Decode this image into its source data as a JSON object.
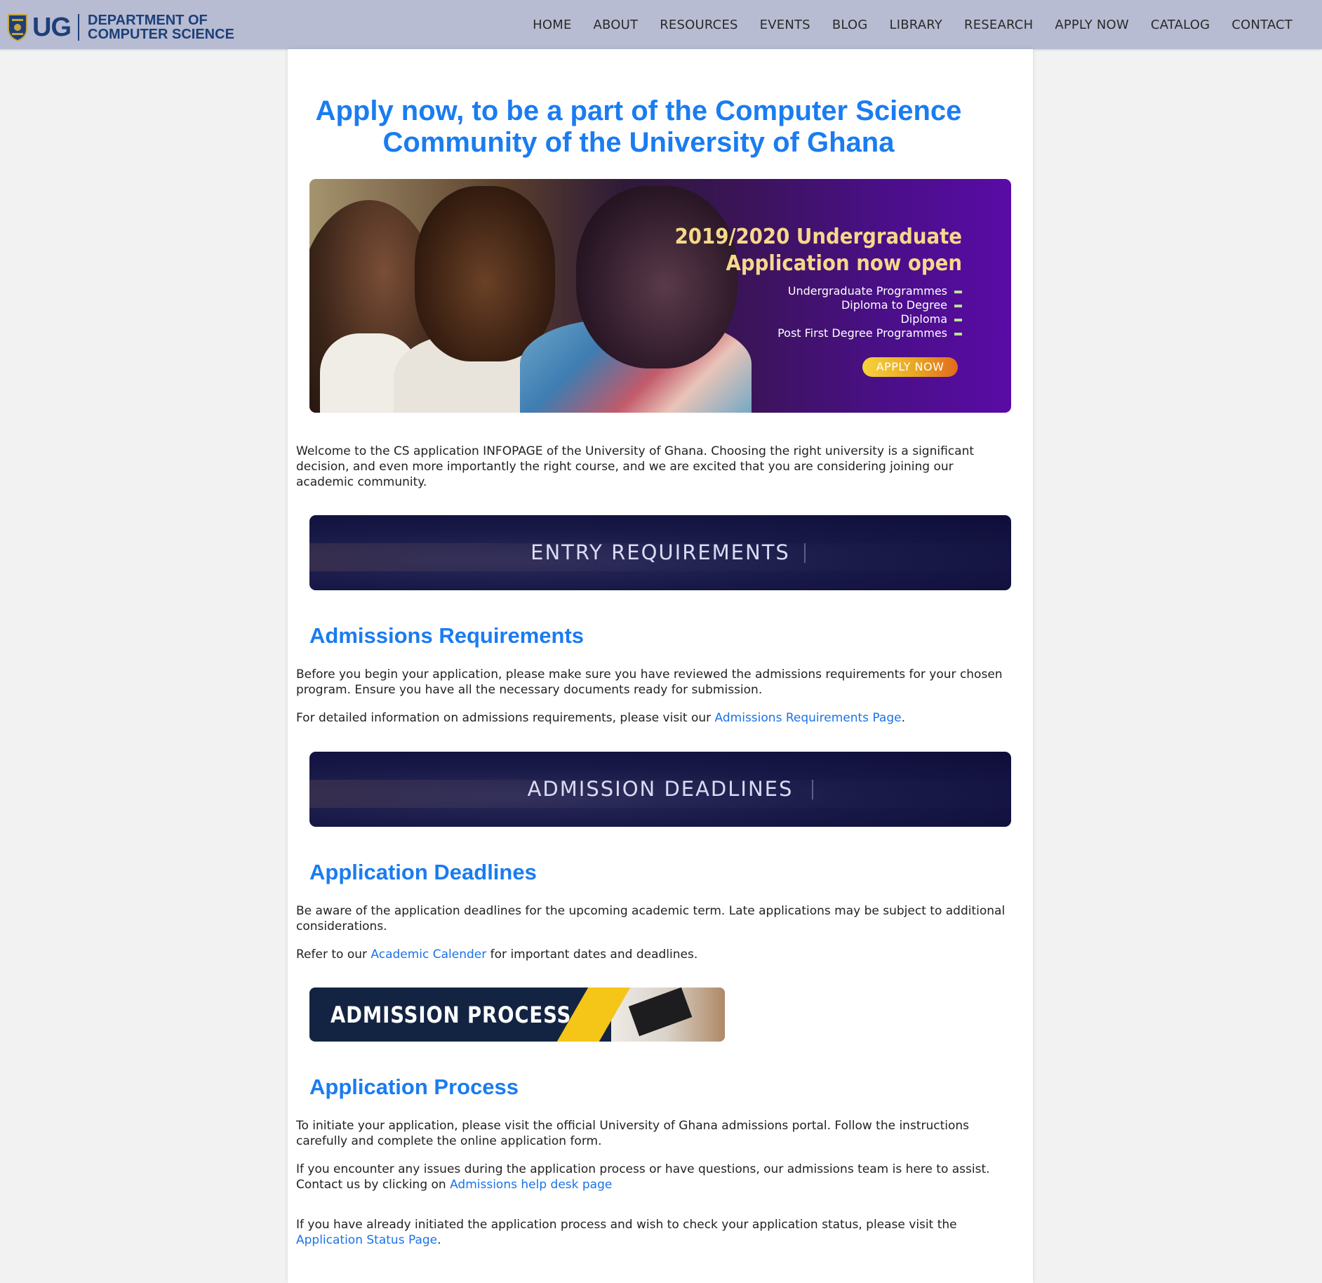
{
  "header": {
    "logo_mark": "UG",
    "dept_line1": "DEPARTMENT OF",
    "dept_line2": "COMPUTER SCIENCE",
    "nav": [
      "HOME",
      "ABOUT",
      "RESOURCES",
      "EVENTS",
      "BLOG",
      "LIBRARY",
      "RESEARCH",
      "APPLY NOW",
      "CATALOG",
      "CONTACT"
    ]
  },
  "main": {
    "headline": "Apply now, to be a part of the Computer Science Community of the University of Ghana",
    "hero": {
      "title_line1": "2019/2020 Undergraduate",
      "title_line2": "Application now open",
      "items": [
        "Undergraduate Programmes",
        "Diploma to Degree",
        "Diploma",
        "Post First Degree Programmes"
      ],
      "button": "APPLY NOW"
    },
    "welcome": "Welcome to the CS application INFOPAGE of the University of Ghana. Choosing the right university is a significant decision, and even more importantly the right course, and we are excited that you are considering joining our academic community.",
    "banner_entry": "ENTRY REQUIREMENTS",
    "admissions": {
      "heading": "Admissions Requirements",
      "p1": "Before you begin your application, please make sure you have reviewed the admissions requirements for your chosen program. Ensure you have all the necessary documents ready for submission.",
      "p2_prefix": "For detailed information on admissions requirements, please visit our ",
      "p2_link": "Admissions Requirements Page",
      "p2_suffix": "."
    },
    "banner_deadlines": "ADMISSION DEADLINES",
    "deadlines": {
      "heading": "Application Deadlines",
      "p1": "Be aware of the application deadlines for the upcoming academic term. Late applications may be subject to additional considerations.",
      "p2_prefix": "Refer to our ",
      "p2_link": "Academic Calender",
      "p2_suffix": " for important dates and deadlines."
    },
    "banner_process": "ADMISSION PROCESS",
    "process": {
      "heading": "Application Process",
      "p1": "To initiate your application, please visit the official University of Ghana admissions portal. Follow the instructions carefully and complete the online application form.",
      "p2_prefix": "If you encounter any issues during the application process or have questions, our admissions team is here to assist. Contact us by clicking on ",
      "p2_link": "Admissions help desk page",
      "p3_prefix": "If you have already initiated the application process and wish to check your application status, please visit the ",
      "p3_link": "Application Status Page",
      "p3_suffix": "."
    }
  },
  "colors": {
    "nav_bg": "#b7bcd2",
    "accent_blue": "#1a7cf0",
    "link_blue": "#1a73e8",
    "banner_navy": "#0e0d3a"
  }
}
